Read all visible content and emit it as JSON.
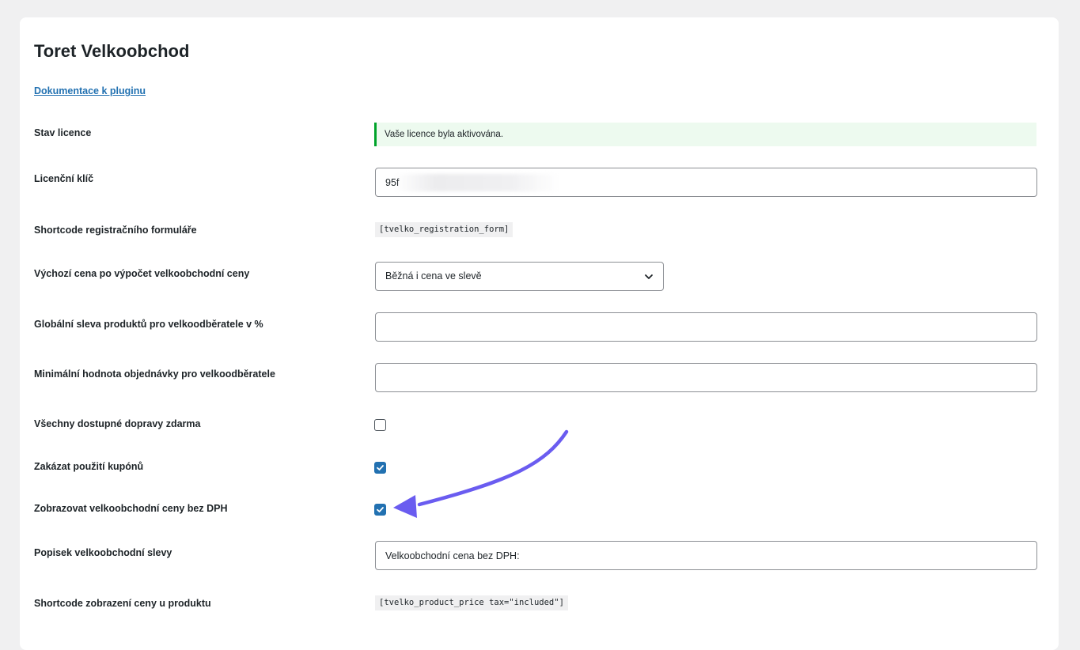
{
  "page": {
    "title": "Toret Velkoobchod",
    "doc_link": "Dokumentace k pluginu"
  },
  "license_status": {
    "label": "Stav licence",
    "message": "Vaše licence byla aktivována.",
    "status_color": "#00a32a"
  },
  "license_key": {
    "label": "Licenční klíč",
    "value": "95f"
  },
  "registration_shortcode": {
    "label": "Shortcode registračního formuláře",
    "code": "[tvelko_registration_form]"
  },
  "default_price": {
    "label": "Výchozí cena po výpočet velkoobchodní ceny",
    "selected": "Běžná i cena ve slevě"
  },
  "global_discount": {
    "label": "Globální sleva produktů pro velkoodběratele v %",
    "value": ""
  },
  "min_order": {
    "label": "Minimální hodnota objednávky pro velkoodběratele",
    "value": ""
  },
  "free_shipping": {
    "label": "Všechny dostupné dopravy zdarma",
    "checked": false
  },
  "disable_coupons": {
    "label": "Zakázat použití kupónů",
    "checked": true
  },
  "show_prices_without_vat": {
    "label": "Zobrazovat velkoobchodní ceny bez DPH",
    "checked": true
  },
  "discount_label": {
    "label": "Popisek velkoobchodní slevy",
    "value": "Velkoobchodní cena bez DPH:"
  },
  "product_price_shortcode": {
    "label": "Shortcode zobrazení ceny u produktu",
    "code": "[tvelko_product_price tax=\"included\"]"
  },
  "colors": {
    "accent": "#2271b1",
    "arrow": "#6a5cf0",
    "success": "#00a32a"
  },
  "icons": {
    "select": "chevron-down-icon",
    "check": "checkmark-icon",
    "annotation": "annotation-arrow-icon"
  }
}
